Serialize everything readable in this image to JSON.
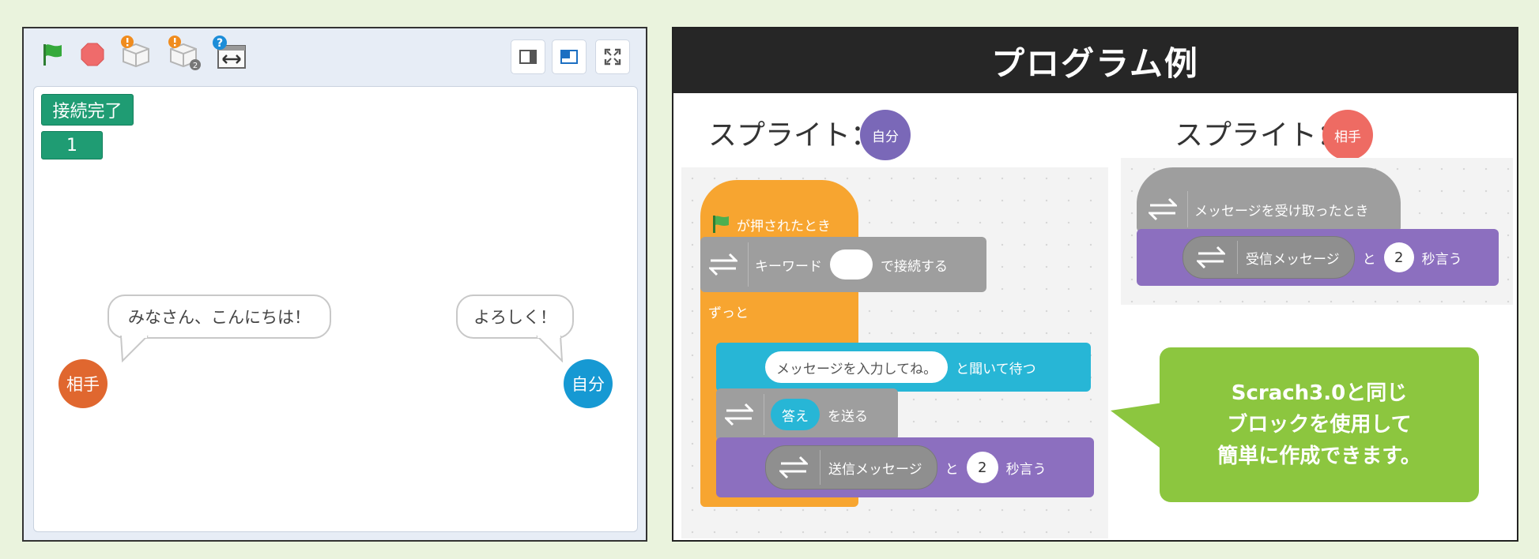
{
  "stage": {
    "monitor_label": "接続完了",
    "monitor_value": "1",
    "left_bubble": "みなさん、こんにちは！",
    "right_bubble": "よろしく！",
    "sprite_opponent": "相手",
    "sprite_self": "自分",
    "extension_badge_count": "2",
    "colors": {
      "opponent": "#e0672f",
      "self": "#1699d3",
      "monitor": "#1f9c73"
    }
  },
  "program": {
    "title": "プログラム例",
    "sprite_prefix": "スプライト：",
    "self_chip": "自分",
    "opponent_chip": "相手",
    "self_script": {
      "hat": "が押されたとき",
      "connect_prefix": "キーワード",
      "connect_suffix": "で接続する",
      "forever": "ずっと",
      "ask_input": "メッセージを入力してね。",
      "ask_suffix": "と聞いて待つ",
      "answer": "答え",
      "send_suffix": "を送る",
      "say_reporter": "送信メッセージ",
      "say_and": "と",
      "say_secs": "2",
      "say_suffix": "秒言う"
    },
    "opponent_script": {
      "hat": "メッセージを受け取ったとき",
      "say_reporter": "受信メッセージ",
      "say_and": "と",
      "say_secs": "2",
      "say_suffix": "秒言う"
    },
    "callout_lines": [
      "Scrach3.0と同じ",
      "ブロックを使用して",
      "簡単に作成できます。"
    ],
    "colors": {
      "events": "#f7a530",
      "extension": "#9e9e9e",
      "sensing": "#27b6d6",
      "looks": "#8c6fbf",
      "callout": "#8cc63f",
      "self_chip": "#7a68b8",
      "opponent_chip": "#ee6b63"
    }
  }
}
